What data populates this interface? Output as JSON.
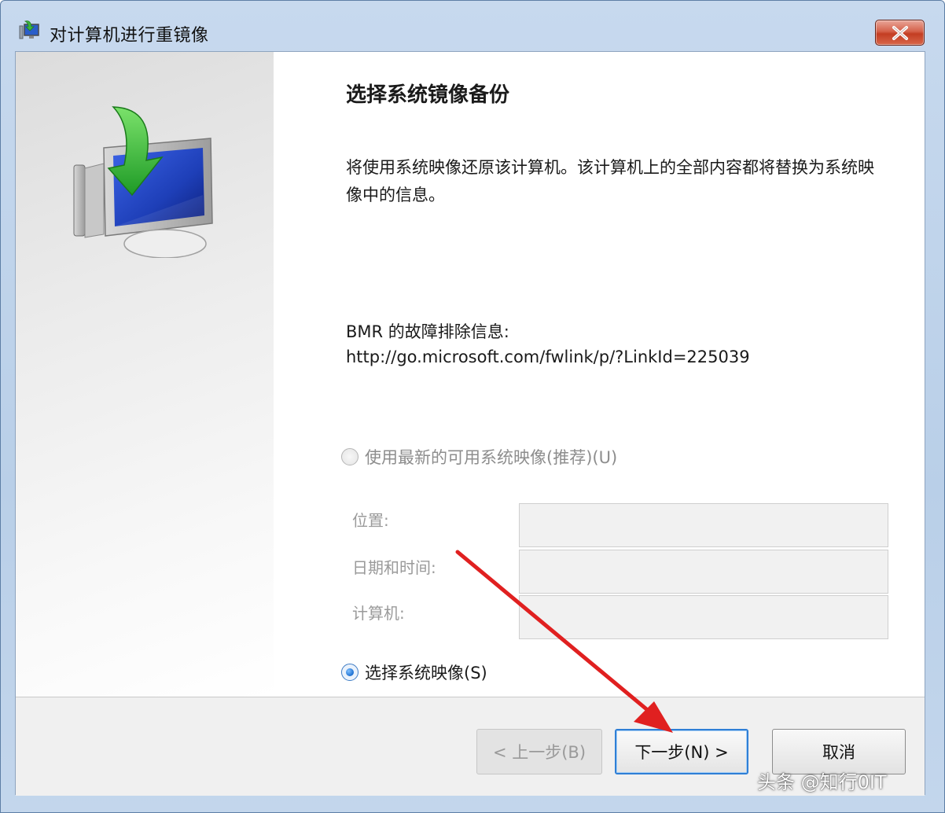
{
  "window": {
    "title": "对计算机进行重镜像"
  },
  "page": {
    "heading": "选择系统镜像备份",
    "description": "将使用系统映像还原该计算机。该计算机上的全部内容都将替换为系统映像中的信息。",
    "bmr_label": "BMR 的故障排除信息:",
    "bmr_link": "http://go.microsoft.com/fwlink/p/?LinkId=225039"
  },
  "options": {
    "latest": {
      "label": "使用最新的可用系统映像(推荐)(U)",
      "checked": false,
      "enabled": false
    },
    "select": {
      "label": "选择系统映像(S)",
      "checked": true,
      "enabled": true
    }
  },
  "fields": {
    "location_label": "位置:",
    "datetime_label": "日期和时间:",
    "computer_label": "计算机:",
    "location_value": "",
    "datetime_value": "",
    "computer_value": ""
  },
  "buttons": {
    "back": "< 上一步(B)",
    "next": "下一步(N) >",
    "cancel": "取消"
  },
  "watermark": "头条 @知行0IT",
  "colors": {
    "title_bar": "#b9cfe8",
    "close_button": "#c33d22",
    "focus_border": "#2f7fd6",
    "annotation_arrow": "#e02020"
  },
  "icons": {
    "app": "restore-computer-icon",
    "hero": "monitor-with-green-arrow-icon",
    "close": "close-icon"
  }
}
